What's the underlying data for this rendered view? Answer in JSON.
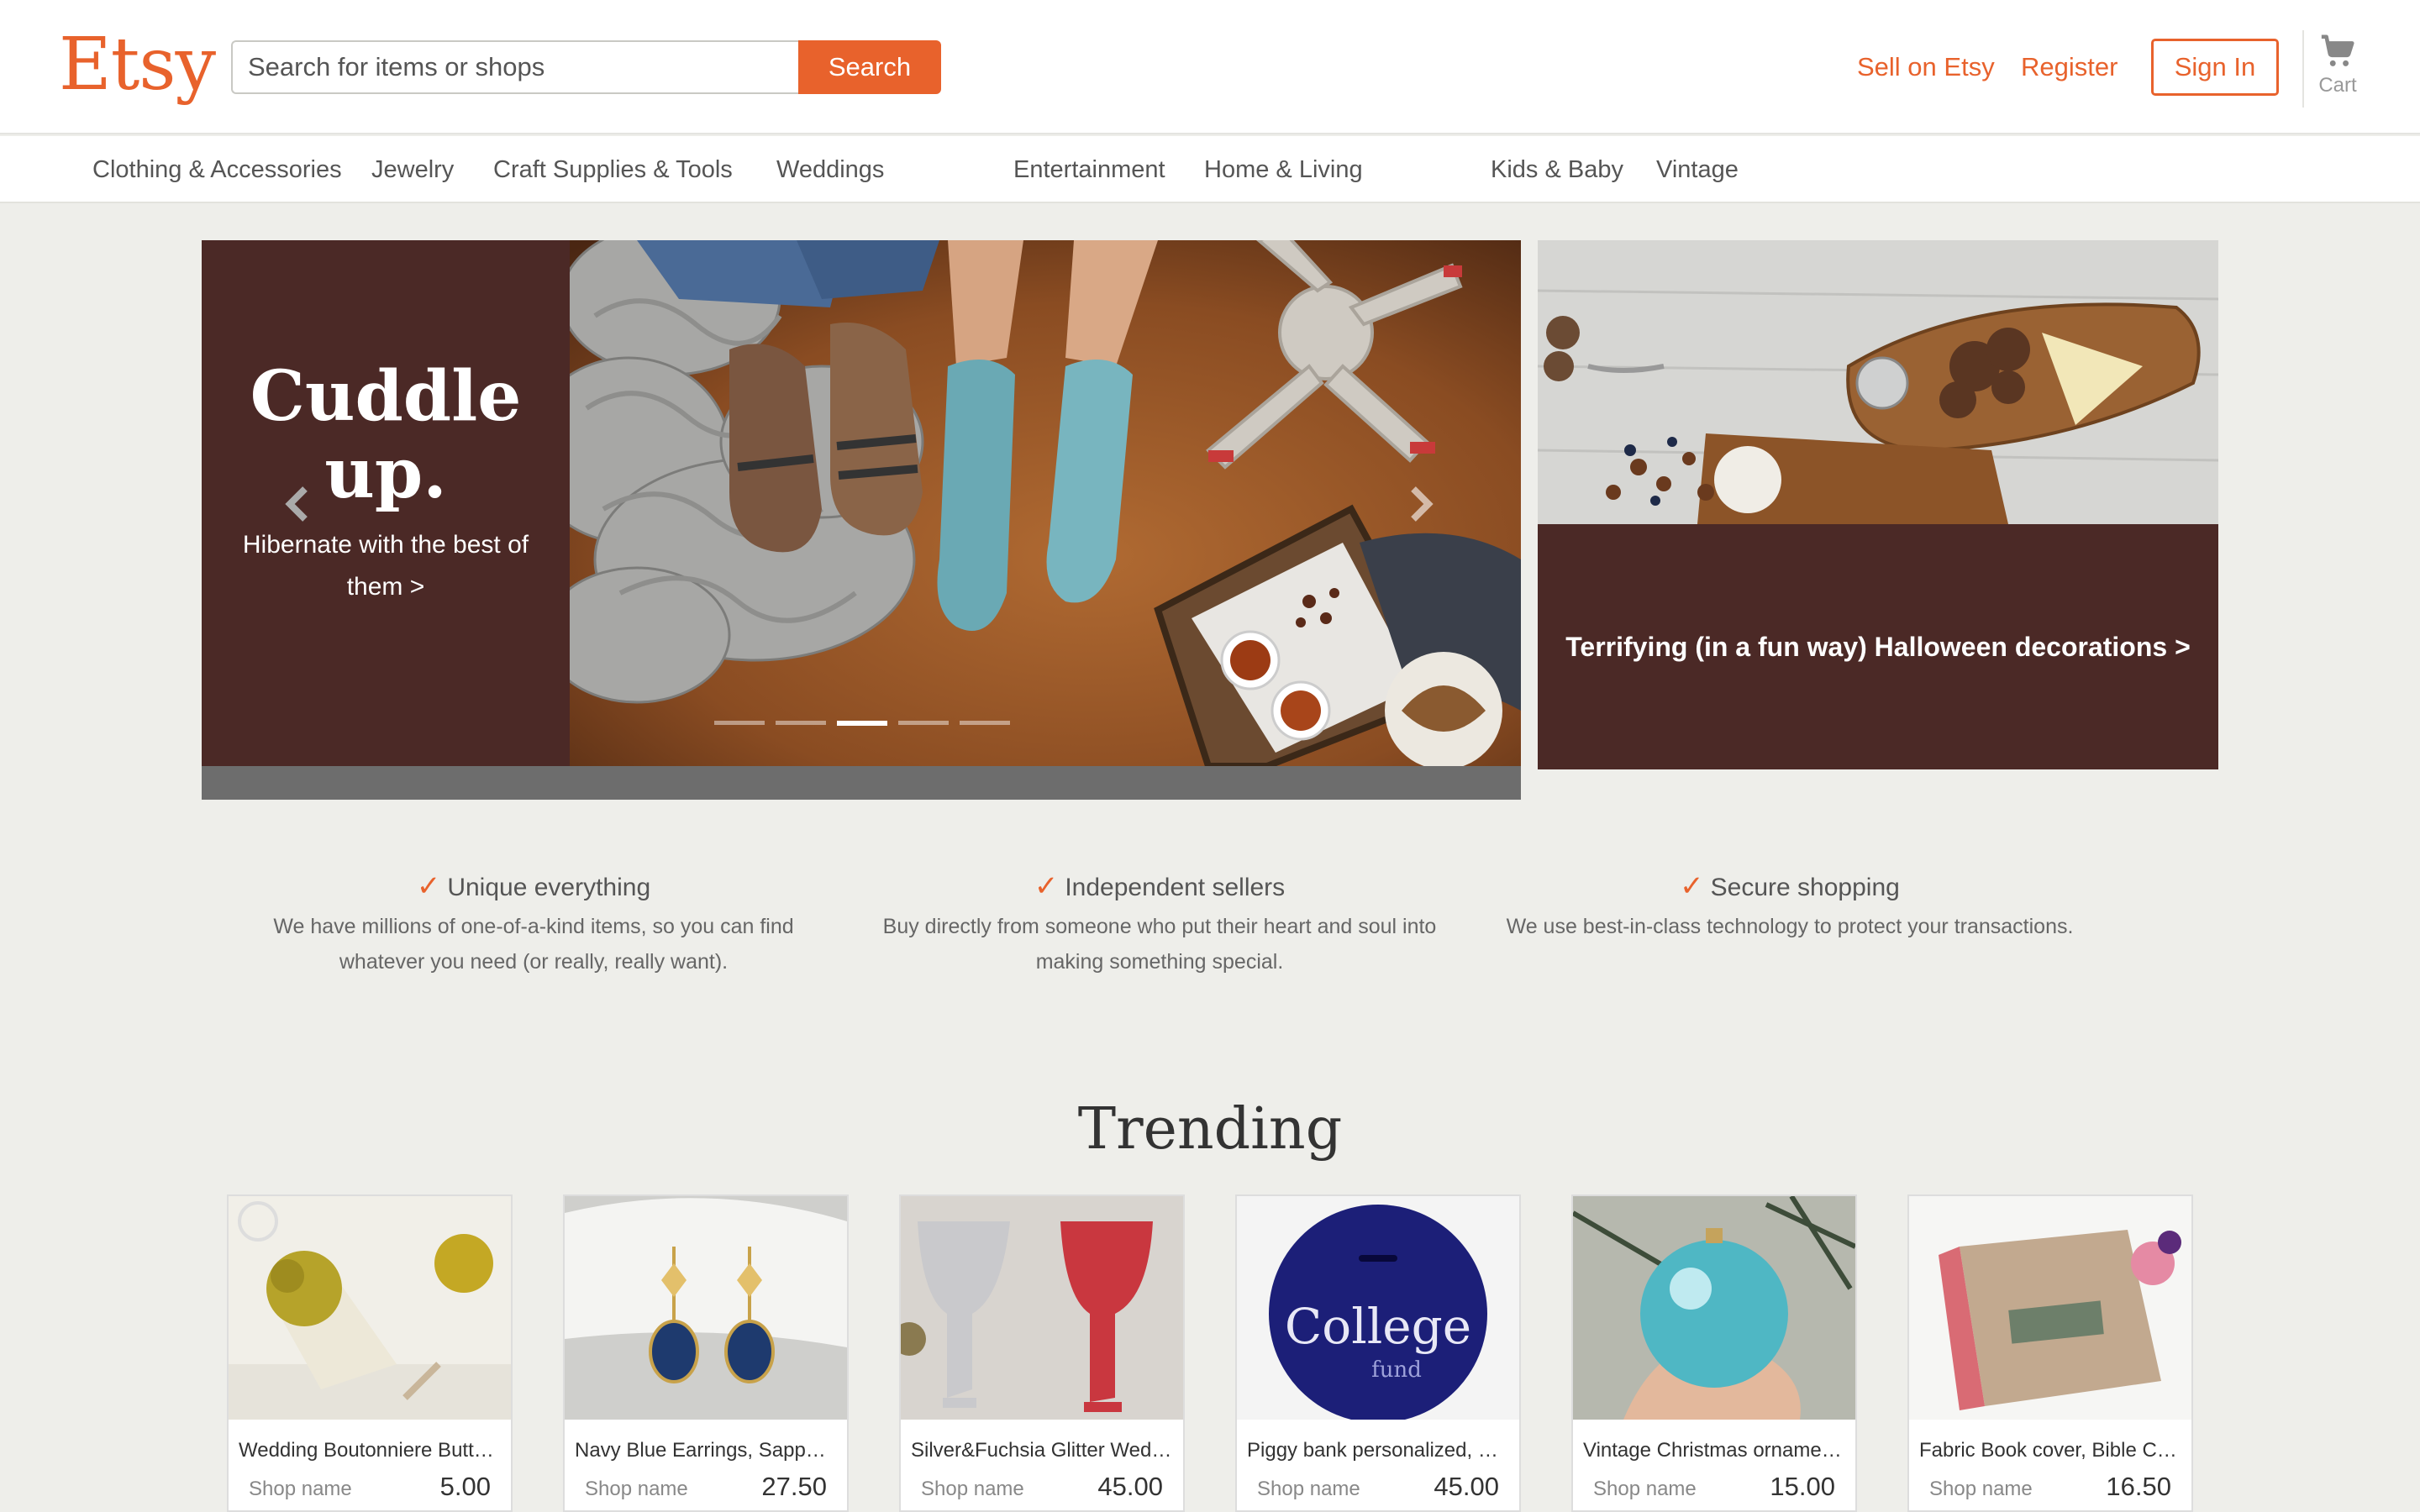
{
  "header": {
    "logo": "Etsy",
    "search_placeholder": "Search for items or shops",
    "search_button": "Search",
    "sell_link": "Sell on Etsy",
    "register_link": "Register",
    "signin_button": "Sign In",
    "cart_label": "Cart"
  },
  "categories": [
    "Clothing & Accessories",
    "Jewelry",
    "Craft Supplies & Tools",
    "Weddings",
    "Entertainment",
    "Home & Living",
    "Kids & Baby",
    "Vintage"
  ],
  "hero": {
    "title": "Cuddle up.",
    "subtitle": "Hibernate with the best of them >",
    "slides": 5,
    "active_slide": 3
  },
  "promo": {
    "text": "Terrifying (in a fun way) Halloween decorations >"
  },
  "value_props": [
    {
      "title": "Unique everything",
      "desc": "We have millions of one-of-a-kind items, so you can find whatever you need (or really, really want)."
    },
    {
      "title": "Independent sellers",
      "desc": "Buy directly from someone who put their heart and soul into making something special."
    },
    {
      "title": "Secure shopping",
      "desc": "We use best-in-class technology to protect your transactions."
    }
  ],
  "trending": {
    "title": "Trending",
    "items": [
      {
        "title": "Wedding Boutonniere Butt…",
        "shop": "Shop name",
        "price": "5.00"
      },
      {
        "title": "Navy Blue Earrings, Sapp…",
        "shop": "Shop name",
        "price": "27.50"
      },
      {
        "title": "Silver&Fuchsia Glitter Wed…",
        "shop": "Shop name",
        "price": "45.00"
      },
      {
        "title": "Piggy bank personalized, …",
        "shop": "Shop name",
        "price": "45.00"
      },
      {
        "title": "Vintage Christmas orname…",
        "shop": "Shop name",
        "price": "15.00"
      },
      {
        "title": "Fabric Book cover, Bible C…",
        "shop": "Shop name",
        "price": "16.50"
      }
    ]
  },
  "colors": {
    "brand": "#e8622c",
    "hero_panel": "#4b2926",
    "page_bg": "#eeeeea"
  }
}
